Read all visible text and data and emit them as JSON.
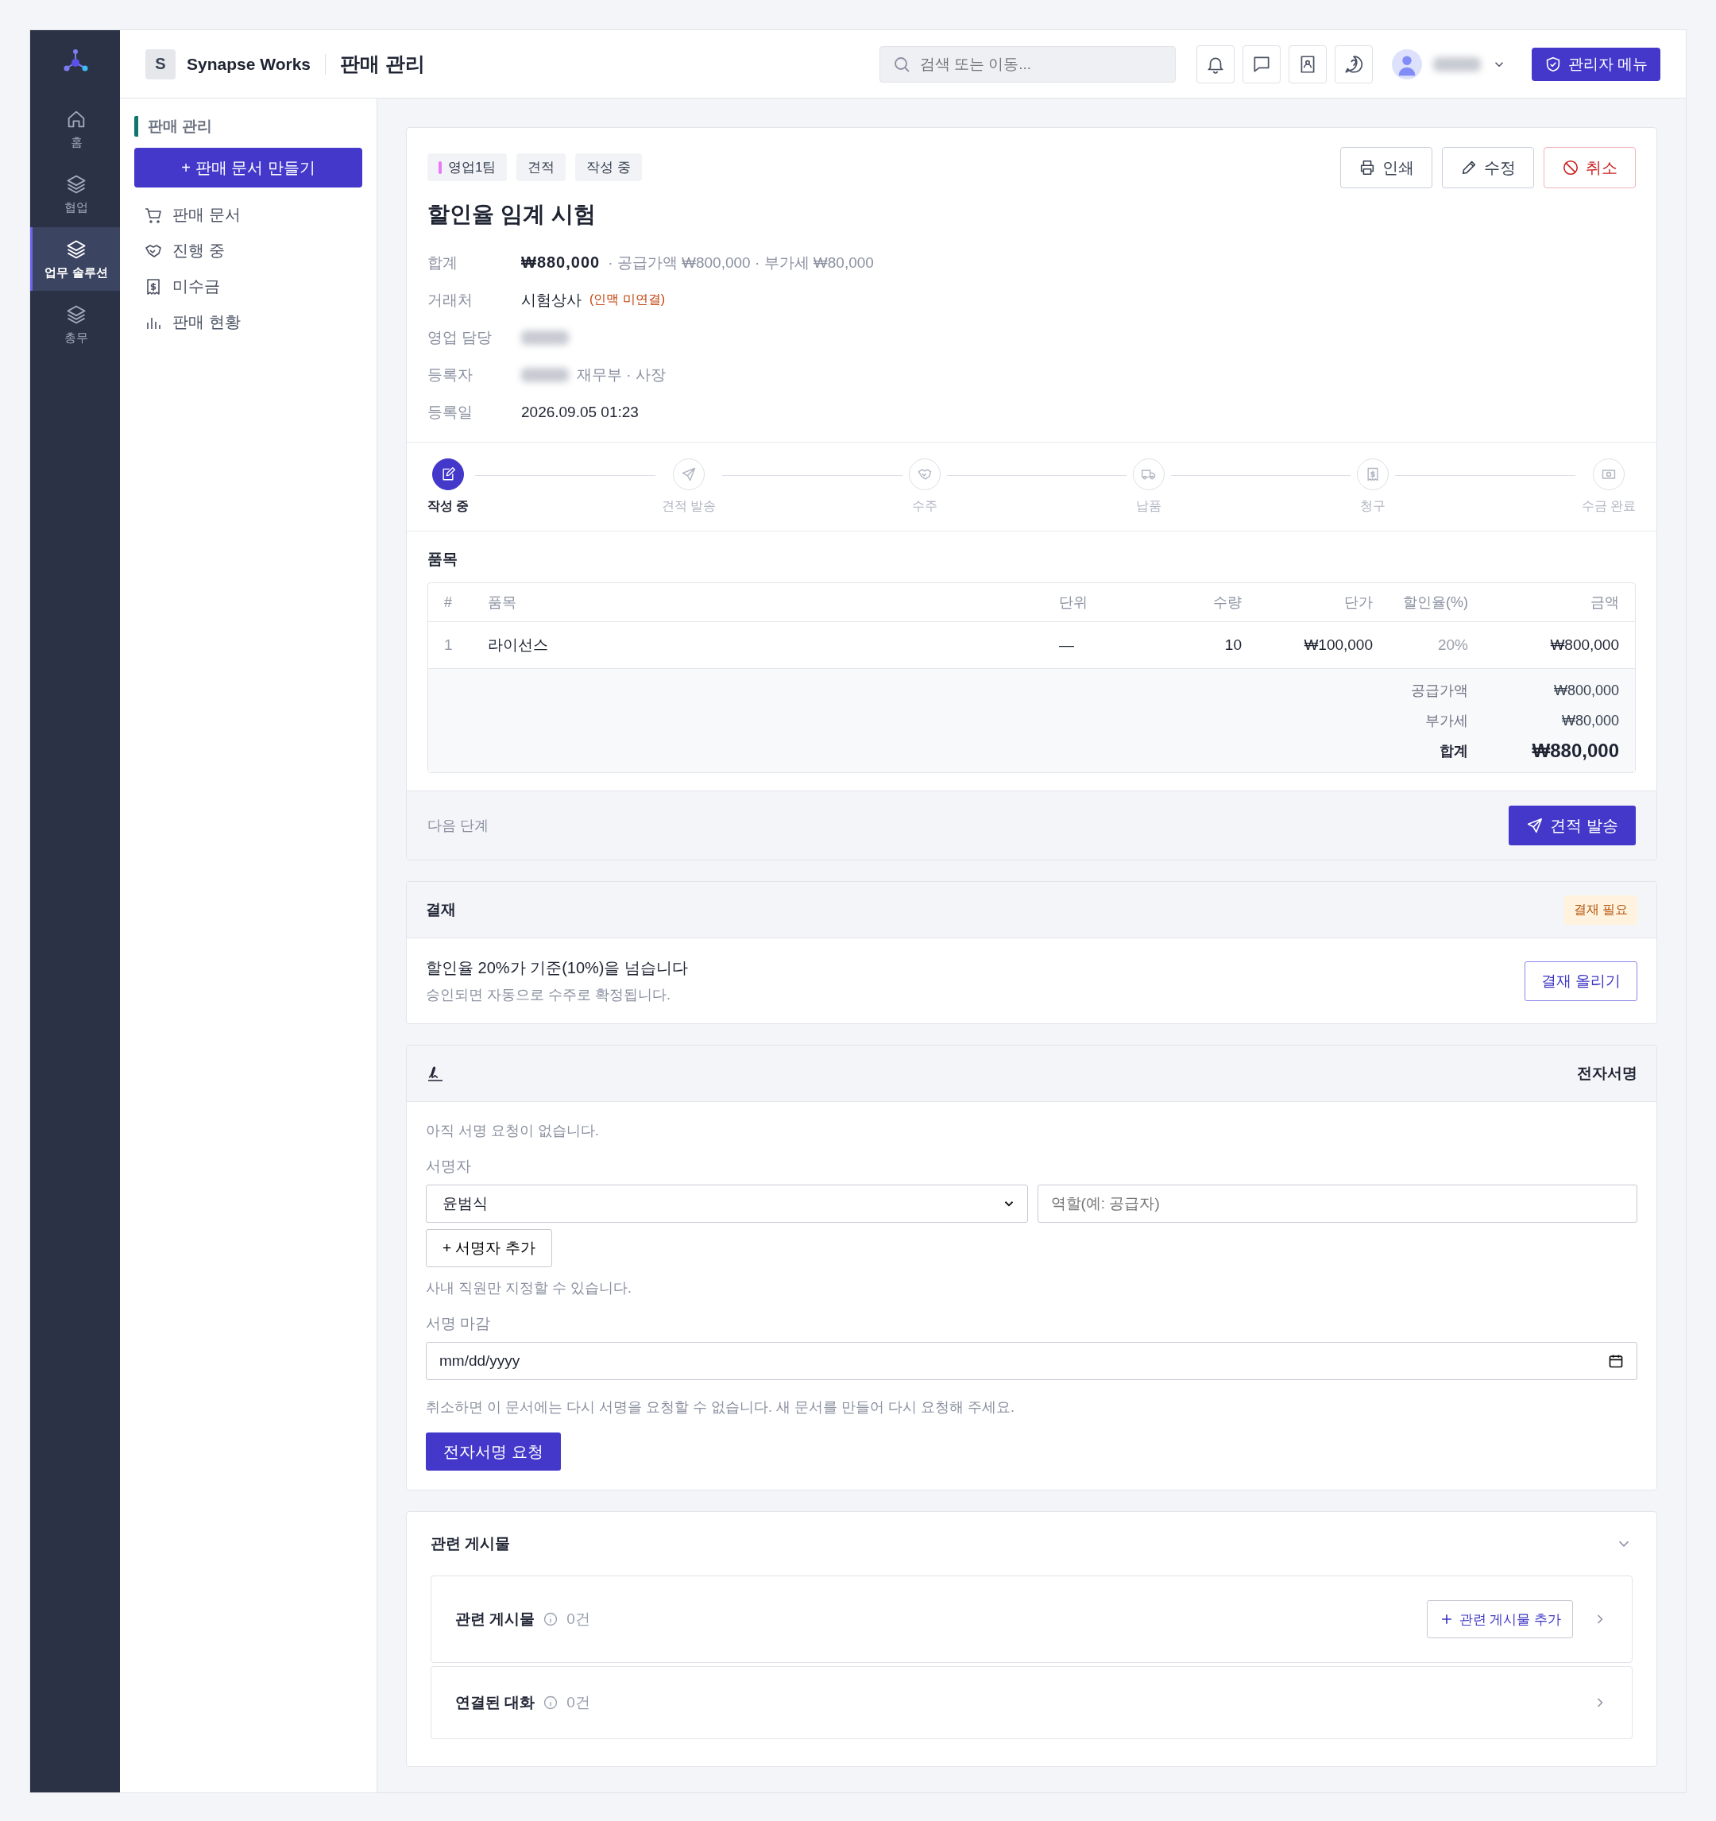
{
  "rail": {
    "items": [
      {
        "label": "홈",
        "selected": false
      },
      {
        "label": "협업",
        "selected": false
      },
      {
        "label": "업무 솔루션",
        "selected": true
      },
      {
        "label": "총무",
        "selected": false
      }
    ]
  },
  "topbar": {
    "brand_initial": "S",
    "brand": "Synapse Works",
    "page_title": "판매 관리",
    "search": {
      "placeholder": "검색 또는 이동..."
    },
    "admin_button": "관리자 메뉴"
  },
  "sidebar": {
    "section": "판매 관리",
    "create_button": "+ 판매 문서 만들기",
    "items": [
      {
        "label": "판매 문서"
      },
      {
        "label": "진행 중"
      },
      {
        "label": "미수금"
      },
      {
        "label": "판매 현황"
      }
    ]
  },
  "document": {
    "tags": [
      {
        "label": "영업1팀",
        "color": "#e879f9"
      },
      {
        "label": "견적"
      },
      {
        "label": "작성 중"
      }
    ],
    "actions": [
      {
        "label": "인쇄",
        "kind": "print"
      },
      {
        "label": "수정",
        "kind": "edit"
      },
      {
        "label": "취소",
        "kind": "danger"
      }
    ],
    "title": "할인율 임계 시험",
    "fields": [
      {
        "label": "합계",
        "kind": "total",
        "value": "₩880,000",
        "detail": "· 공급가액 ₩800,000 · 부가세 ₩80,000"
      },
      {
        "label": "거래처",
        "kind": "text",
        "value": "시험상사",
        "note": "(인맥 미연결)"
      },
      {
        "label": "영업 담당",
        "kind": "redacted"
      },
      {
        "label": "등록자",
        "kind": "redacted",
        "detail": "재무부 · 사장"
      },
      {
        "label": "등록일",
        "kind": "text",
        "value": "2026.09.05 01:23"
      }
    ],
    "steps": [
      {
        "label": "작성 중",
        "selected": true
      },
      {
        "label": "견적 발송",
        "selected": false
      },
      {
        "label": "수주",
        "selected": false
      },
      {
        "label": "납품",
        "selected": false
      },
      {
        "label": "청구",
        "selected": false
      },
      {
        "label": "수금 완료",
        "selected": false
      }
    ],
    "items": {
      "title": "품목",
      "columns": [
        "#",
        "품목",
        "단위",
        "수량",
        "단가",
        "할인율(%)",
        "금액"
      ],
      "rows": [
        [
          "1",
          "라이선스",
          "—",
          "10",
          "₩100,000",
          "20%",
          "₩800,000"
        ]
      ],
      "totals": [
        {
          "label": "공급가액",
          "value": "₩800,000",
          "kind": "sub"
        },
        {
          "label": "부가세",
          "value": "₩80,000",
          "kind": "sub"
        },
        {
          "label": "합계",
          "value": "₩880,000",
          "kind": "grand"
        }
      ]
    },
    "next_step": {
      "label": "다음 단계",
      "button": "견적 발송"
    }
  },
  "approval": {
    "title": "결재",
    "badge": "결재 필요",
    "message": "할인율 20%가 기준(10%)을 넘습니다",
    "sub": "승인되면 자동으로 수주로 확정됩니다.",
    "button": "결재 올리기"
  },
  "esign": {
    "title": "전자서명",
    "empty": "아직 서명 요청이 없습니다.",
    "signer_label": "서명자",
    "signer_value": "윤범식",
    "role_placeholder": "역할(예: 공급자)",
    "add_button": "+ 서명자 추가",
    "hint": "사내 직원만 지정할 수 있습니다.",
    "deadline_label": "서명 마감",
    "deadline_placeholder": "mm/dd/yyyy",
    "warning": "취소하면 이 문서에는 다시 서명을 요청할 수 없습니다. 새 문서를 만들어 다시 요청해 주세요.",
    "submit": "전자서명 요청"
  },
  "related": {
    "title": "관련 게시물",
    "expanded": true,
    "sections": [
      {
        "title": "관련 게시물",
        "count": "0건",
        "button": "관련 게시물 추가"
      },
      {
        "title": "연결된 대화",
        "count": "0건"
      }
    ]
  }
}
